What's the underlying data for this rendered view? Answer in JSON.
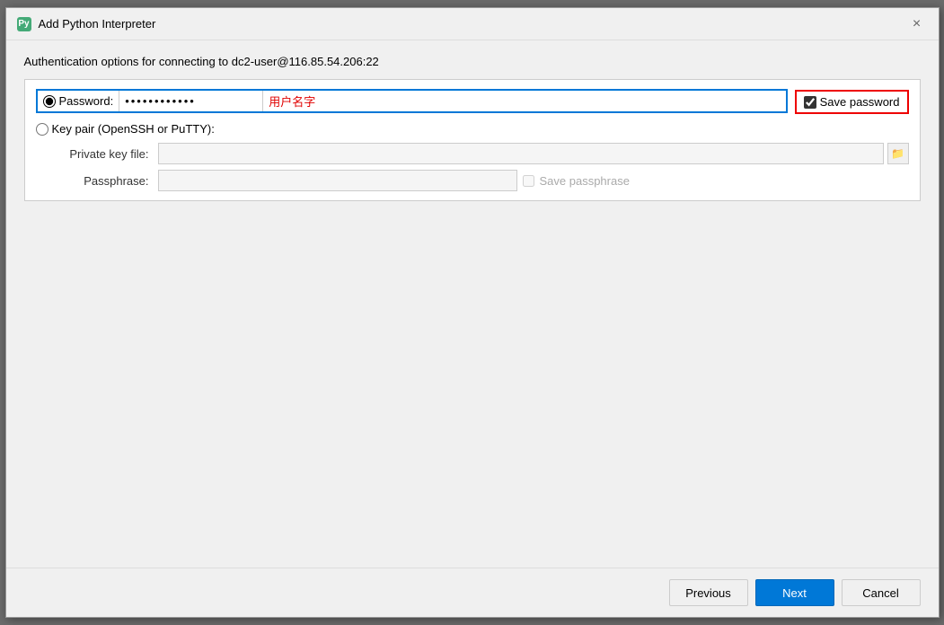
{
  "titleBar": {
    "iconLabel": "Py",
    "title": "Add Python Interpreter",
    "closeLabel": "×"
  },
  "subtitle": "Authentication options for connecting to dc2-user@116.85.54.206:22",
  "passwordSection": {
    "radioLabel": "Password:",
    "passwordValue": "············",
    "usernameValue": "用户名字",
    "savePasswordLabel": "Save password",
    "savePasswordChecked": true
  },
  "keypairSection": {
    "radioLabel": "Key pair (OpenSSH or PuTTY):",
    "privateKeyLabel": "Private key file:",
    "privateKeyValue": "",
    "passphraseLabel": "Passphrase:",
    "passphraseValue": "",
    "savePassphraseLabel": "Save passphrase"
  },
  "footer": {
    "previousLabel": "Previous",
    "nextLabel": "Next",
    "cancelLabel": "Cancel"
  }
}
